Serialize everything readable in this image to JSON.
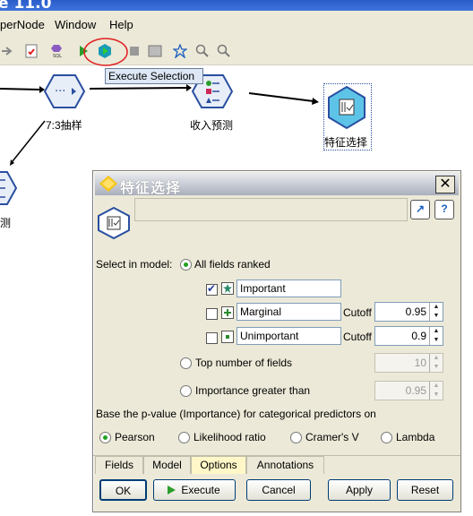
{
  "window": {
    "title": "e 11.0"
  },
  "menu": [
    "perNode",
    "Window",
    "Help"
  ],
  "toolbar": {
    "tooltip": "Execute Selection",
    "icons": [
      "arrow-icon",
      "report-icon",
      "sql-icon",
      "run-icon",
      "execute-selection-icon",
      "stop-icon",
      "preview-icon",
      "star-icon",
      "zoom-in-icon",
      "zoom-out-icon"
    ]
  },
  "canvas": {
    "nodes": [
      {
        "label": "7:3抽样",
        "icon": "sample-node-icon"
      },
      {
        "label": "收入预测",
        "icon": "partition-node-icon"
      },
      {
        "label": "特征选择",
        "icon": "feature-selection-node-icon"
      },
      {
        "label": "预测",
        "icon": "partition-node-icon"
      }
    ]
  },
  "dialog": {
    "title": "特征选择",
    "select_in_model_label": "Select in model:",
    "options": {
      "all_fields_ranked": "All fields ranked",
      "important": {
        "label": "Important",
        "checked": true
      },
      "marginal": {
        "label": "Marginal",
        "checked": false,
        "cutoff_label": "Cutoff",
        "cutoff": "0.95"
      },
      "unimportant": {
        "label": "Unimportant",
        "checked": false,
        "cutoff_label": "Cutoff",
        "cutoff": "0.9"
      },
      "top_number": {
        "label": "Top number of fields",
        "value": "10"
      },
      "importance_greater": {
        "label": "Importance greater than",
        "value": "0.95"
      }
    },
    "pvalue_label": "Base the p-value (Importance) for categorical predictors on",
    "pvalue_options": [
      "Pearson",
      "Likelihood ratio",
      "Cramer's V",
      "Lambda"
    ],
    "pvalue_selected": "Pearson",
    "tabs": [
      "Fields",
      "Model",
      "Options",
      "Annotations"
    ],
    "active_tab": "Options",
    "buttons": {
      "ok": "OK",
      "execute": "Execute",
      "cancel": "Cancel",
      "apply": "Apply",
      "reset": "Reset"
    }
  },
  "colors": {
    "accent": "#3f74dc",
    "active_tab": "#fff7c8",
    "highlight_circle": "#e02020"
  }
}
